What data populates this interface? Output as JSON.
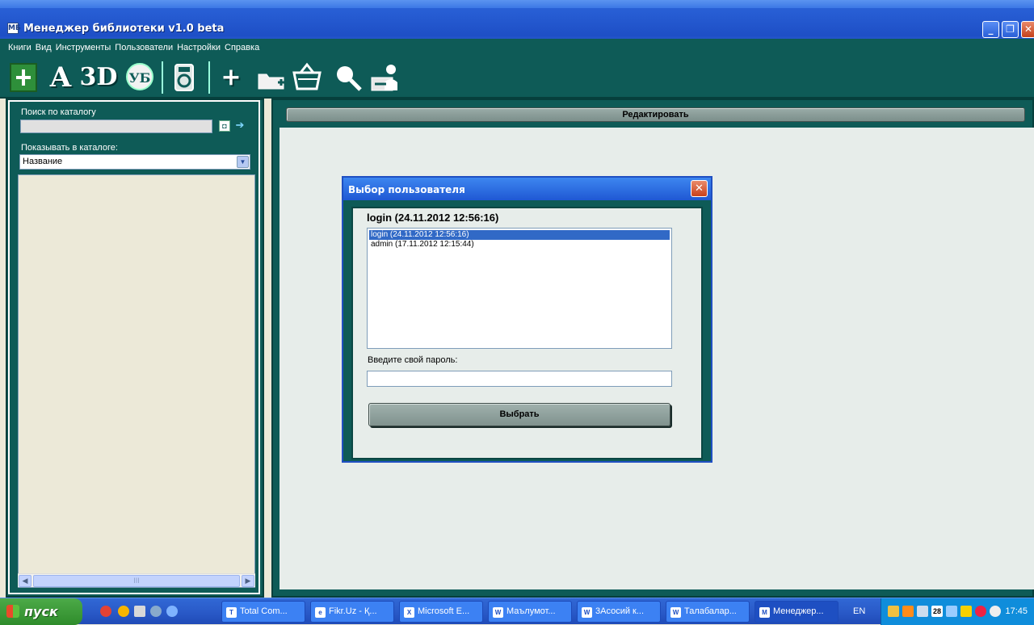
{
  "window": {
    "title": "Менеджер библиотеки v1.0 beta",
    "app_icon": "mb-icon",
    "controls": [
      "minimize-icon",
      "restore-icon",
      "close-icon"
    ]
  },
  "menu": {
    "items": [
      "Книги",
      "Вид",
      "Инструменты",
      "Пользователи",
      "Настройки",
      "Справка"
    ]
  },
  "toolbar": {
    "letter_a": "A",
    "letter_3d": "3D",
    "badge": "УБ",
    "plus": "+",
    "icons": [
      "catalog-grid-icon",
      "author-icon",
      "3d-icon",
      "badge-icon",
      "disk-icon",
      "add-icon",
      "folder-add-icon",
      "basket-icon",
      "search-icon",
      "user-export-icon"
    ]
  },
  "sidebar": {
    "search_label": "Поиск по каталогу",
    "search_value": "",
    "show_label": "Показывать в каталоге:",
    "show_selected": "Название",
    "scroll_thumb": "III"
  },
  "main": {
    "edit_button": "Редактировать"
  },
  "dialog": {
    "title": "Выбор пользователя",
    "current_user": "login (24.11.2012 12:56:16)",
    "users": [
      {
        "label": "login (24.11.2012 12:56:16)",
        "selected": true
      },
      {
        "label": "admin (17.11.2012 12:15:44)",
        "selected": false
      }
    ],
    "password_label": "Введите свой пароль:",
    "password_value": "",
    "choose_button": "Выбрать"
  },
  "taskbar": {
    "start_label": "пуск",
    "tasks": [
      "Total Com...",
      "Fikr.Uz - Қ...",
      "Microsoft E...",
      "Маълумот...",
      "3Асосий к...",
      "Талабалар...",
      "Менеджер..."
    ],
    "language": "EN",
    "tray_date_badge": "28",
    "clock": "17:45"
  },
  "colors": {
    "panel_teal": "#0E5B57",
    "xp_blue": "#2456CC",
    "selection": "#3169C6"
  }
}
